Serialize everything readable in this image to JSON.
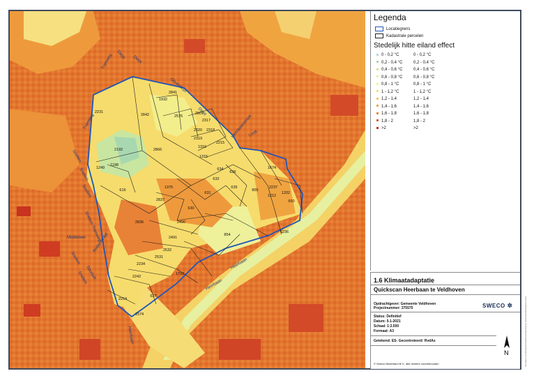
{
  "legend": {
    "title": "Legenda",
    "boundary_label": "Locatiegrens",
    "parcel_label": "Kadastrale percelen",
    "heat_title": "Stedelijk hitte eiland effect",
    "classes": [
      {
        "a": "0 - 0,2 °C",
        "b": "0 - 0,2 °C",
        "color": "#b8d4e4"
      },
      {
        "a": "0,2 - 0,4 °C",
        "b": "0,2 - 0,4 °C",
        "color": "#a8d8b0"
      },
      {
        "a": "0,4 - 0,6 °C",
        "b": "0,4 - 0,6 °C",
        "color": "#c8e6a0"
      },
      {
        "a": "0,6 - 0,8 °C",
        "b": "0,6 - 0,8 °C",
        "color": "#e6f0a0"
      },
      {
        "a": "0,8 - 1 °C",
        "b": "0,8 - 1 °C",
        "color": "#f6f28c"
      },
      {
        "a": "1 - 1,2 °C",
        "b": "1 - 1,2 °C",
        "color": "#f8e070"
      },
      {
        "a": "1,2 - 1,4",
        "b": "1,2 - 1,4",
        "color": "#f6c456"
      },
      {
        "a": "1,4 - 1,6",
        "b": "1,4 - 1,6",
        "color": "#f2a444"
      },
      {
        "a": "1,6 - 1,8",
        "b": "1,6 - 1,8",
        "color": "#ea8236"
      },
      {
        "a": "1,8 - 2",
        "b": "1,8 - 2",
        "color": "#de5a2a"
      },
      {
        "a": ">2",
        "b": ">2",
        "color": "#c8321e"
      }
    ]
  },
  "titleblock": {
    "title": "1.6 Klimaatadaptatie",
    "subtitle": "Quickscan Heerbaan te Veldhoven",
    "client": "Opdrachtgever: Gemeente Veldhoven",
    "project": "Projectnummer: 375575",
    "status": "Status: Definitief",
    "date": "Datum: 5-1-2021",
    "scale": "Schaal: 1:2.500",
    "format": "Formaat: A3",
    "drawn": "Getekend: ES- Gecontroleerd: RvdAs",
    "copyright": "© Sweco Nederland B.V., alle rechten voorbehouden",
    "logo": "SWECO",
    "north": "N"
  },
  "sidebar": "\\\\nl.sweco.com\\Projecten\\Veldhoven\\Quickscan Heerbaan\\GIS\\Kaarten.mxd",
  "map": {
    "streets": [
      "Diept",
      "Diept",
      "Oliverdiept",
      "Tramweg",
      "Snelem",
      "Snelem",
      "Snelem",
      "Snelem-Tramweg",
      "Middelwei",
      "Rodenstraat",
      "Sporkelt",
      "Snelem",
      "Snelem",
      "Heerbaan",
      "Heerbaan",
      "Heerbaan",
      "Reijhoven",
      "Lindt",
      "Heerbaanstraat",
      "Oogst"
    ],
    "parcels": [
      "2231",
      "2841",
      "1932",
      "2842",
      "2576",
      "2807",
      "2317",
      "2320",
      "2318",
      "2319",
      "2215",
      "1316",
      "1315",
      "2192",
      "2866",
      "1198",
      "1249",
      "634",
      "632",
      "636",
      "635",
      "1674",
      "616",
      "1375",
      "631",
      "855",
      "2837",
      "630",
      "2836",
      "2490",
      "854",
      "6236",
      "2491",
      "2532",
      "2531",
      "1793",
      "2234",
      "2242",
      "2254",
      "627",
      "1574",
      "2237",
      "1202",
      "650",
      "1212"
    ]
  }
}
